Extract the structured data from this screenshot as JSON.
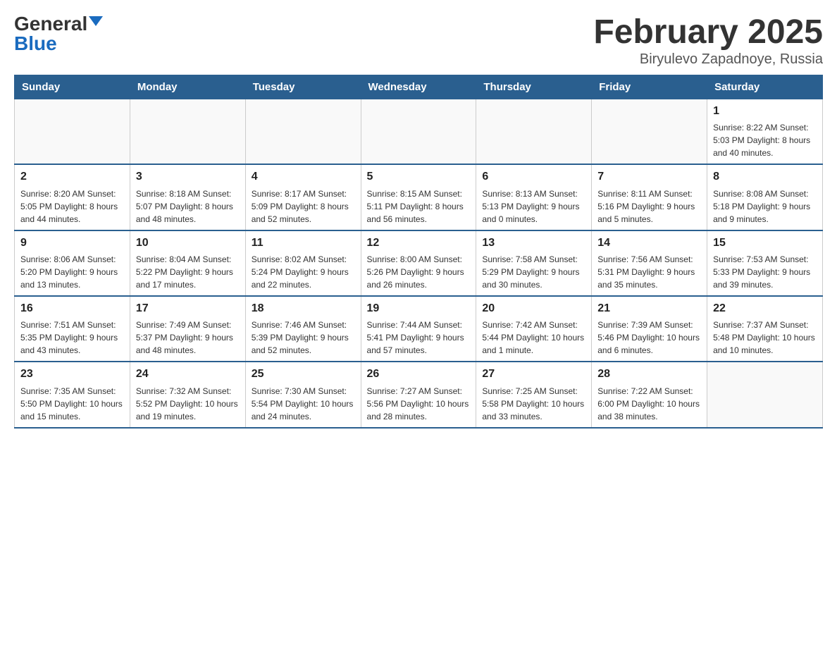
{
  "logo": {
    "general": "General",
    "blue": "Blue"
  },
  "title": "February 2025",
  "subtitle": "Biryulevo Zapadnoye, Russia",
  "weekdays": [
    "Sunday",
    "Monday",
    "Tuesday",
    "Wednesday",
    "Thursday",
    "Friday",
    "Saturday"
  ],
  "weeks": [
    [
      {
        "day": "",
        "info": ""
      },
      {
        "day": "",
        "info": ""
      },
      {
        "day": "",
        "info": ""
      },
      {
        "day": "",
        "info": ""
      },
      {
        "day": "",
        "info": ""
      },
      {
        "day": "",
        "info": ""
      },
      {
        "day": "1",
        "info": "Sunrise: 8:22 AM\nSunset: 5:03 PM\nDaylight: 8 hours and 40 minutes."
      }
    ],
    [
      {
        "day": "2",
        "info": "Sunrise: 8:20 AM\nSunset: 5:05 PM\nDaylight: 8 hours and 44 minutes."
      },
      {
        "day": "3",
        "info": "Sunrise: 8:18 AM\nSunset: 5:07 PM\nDaylight: 8 hours and 48 minutes."
      },
      {
        "day": "4",
        "info": "Sunrise: 8:17 AM\nSunset: 5:09 PM\nDaylight: 8 hours and 52 minutes."
      },
      {
        "day": "5",
        "info": "Sunrise: 8:15 AM\nSunset: 5:11 PM\nDaylight: 8 hours and 56 minutes."
      },
      {
        "day": "6",
        "info": "Sunrise: 8:13 AM\nSunset: 5:13 PM\nDaylight: 9 hours and 0 minutes."
      },
      {
        "day": "7",
        "info": "Sunrise: 8:11 AM\nSunset: 5:16 PM\nDaylight: 9 hours and 5 minutes."
      },
      {
        "day": "8",
        "info": "Sunrise: 8:08 AM\nSunset: 5:18 PM\nDaylight: 9 hours and 9 minutes."
      }
    ],
    [
      {
        "day": "9",
        "info": "Sunrise: 8:06 AM\nSunset: 5:20 PM\nDaylight: 9 hours and 13 minutes."
      },
      {
        "day": "10",
        "info": "Sunrise: 8:04 AM\nSunset: 5:22 PM\nDaylight: 9 hours and 17 minutes."
      },
      {
        "day": "11",
        "info": "Sunrise: 8:02 AM\nSunset: 5:24 PM\nDaylight: 9 hours and 22 minutes."
      },
      {
        "day": "12",
        "info": "Sunrise: 8:00 AM\nSunset: 5:26 PM\nDaylight: 9 hours and 26 minutes."
      },
      {
        "day": "13",
        "info": "Sunrise: 7:58 AM\nSunset: 5:29 PM\nDaylight: 9 hours and 30 minutes."
      },
      {
        "day": "14",
        "info": "Sunrise: 7:56 AM\nSunset: 5:31 PM\nDaylight: 9 hours and 35 minutes."
      },
      {
        "day": "15",
        "info": "Sunrise: 7:53 AM\nSunset: 5:33 PM\nDaylight: 9 hours and 39 minutes."
      }
    ],
    [
      {
        "day": "16",
        "info": "Sunrise: 7:51 AM\nSunset: 5:35 PM\nDaylight: 9 hours and 43 minutes."
      },
      {
        "day": "17",
        "info": "Sunrise: 7:49 AM\nSunset: 5:37 PM\nDaylight: 9 hours and 48 minutes."
      },
      {
        "day": "18",
        "info": "Sunrise: 7:46 AM\nSunset: 5:39 PM\nDaylight: 9 hours and 52 minutes."
      },
      {
        "day": "19",
        "info": "Sunrise: 7:44 AM\nSunset: 5:41 PM\nDaylight: 9 hours and 57 minutes."
      },
      {
        "day": "20",
        "info": "Sunrise: 7:42 AM\nSunset: 5:44 PM\nDaylight: 10 hours and 1 minute."
      },
      {
        "day": "21",
        "info": "Sunrise: 7:39 AM\nSunset: 5:46 PM\nDaylight: 10 hours and 6 minutes."
      },
      {
        "day": "22",
        "info": "Sunrise: 7:37 AM\nSunset: 5:48 PM\nDaylight: 10 hours and 10 minutes."
      }
    ],
    [
      {
        "day": "23",
        "info": "Sunrise: 7:35 AM\nSunset: 5:50 PM\nDaylight: 10 hours and 15 minutes."
      },
      {
        "day": "24",
        "info": "Sunrise: 7:32 AM\nSunset: 5:52 PM\nDaylight: 10 hours and 19 minutes."
      },
      {
        "day": "25",
        "info": "Sunrise: 7:30 AM\nSunset: 5:54 PM\nDaylight: 10 hours and 24 minutes."
      },
      {
        "day": "26",
        "info": "Sunrise: 7:27 AM\nSunset: 5:56 PM\nDaylight: 10 hours and 28 minutes."
      },
      {
        "day": "27",
        "info": "Sunrise: 7:25 AM\nSunset: 5:58 PM\nDaylight: 10 hours and 33 minutes."
      },
      {
        "day": "28",
        "info": "Sunrise: 7:22 AM\nSunset: 6:00 PM\nDaylight: 10 hours and 38 minutes."
      },
      {
        "day": "",
        "info": ""
      }
    ]
  ]
}
